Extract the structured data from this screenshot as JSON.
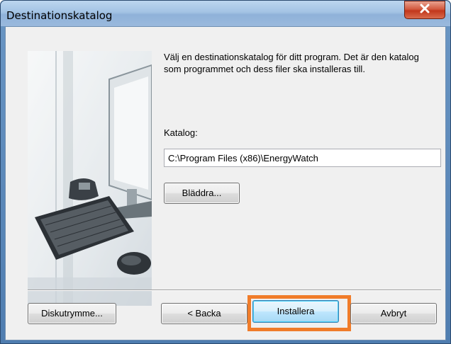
{
  "window": {
    "title": "Destinationskatalog"
  },
  "content": {
    "description": "Välj en destinationskatalog för ditt program. Det är den katalog som programmet och dess filer ska installeras till.",
    "katalog_label": "Katalog:",
    "path_value": "C:\\Program Files (x86)\\EnergyWatch"
  },
  "buttons": {
    "browse": "Bläddra...",
    "disk_space": "Diskutrymme...",
    "back": "< Backa",
    "install": "Installera",
    "cancel": "Avbryt"
  },
  "icons": {
    "close": "close-icon",
    "illustration": "computer-desk-illustration"
  },
  "colors": {
    "highlight": "#f07c2a",
    "close_button": "#c2371c"
  }
}
